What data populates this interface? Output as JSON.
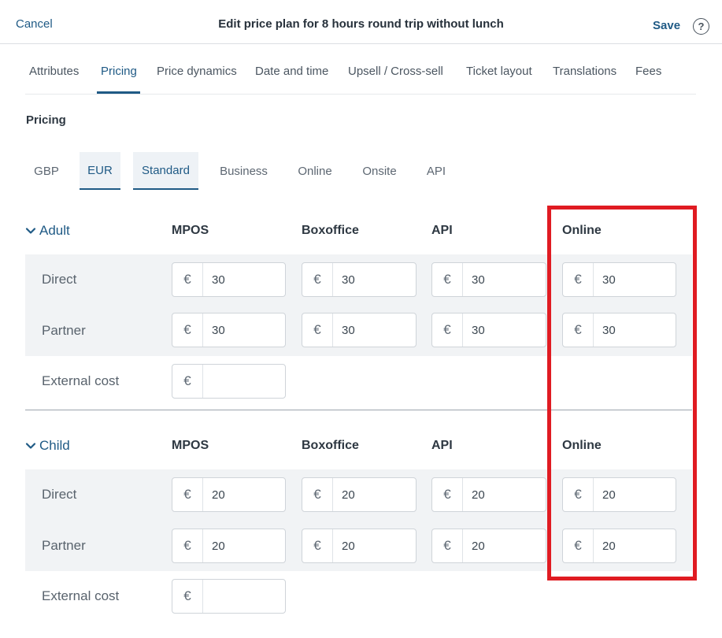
{
  "header": {
    "cancel_label": "Cancel",
    "title": "Edit price plan for 8 hours round trip without lunch",
    "save_label": "Save",
    "help_icon": "?"
  },
  "tabs": [
    {
      "label": "Attributes"
    },
    {
      "label": "Pricing",
      "active": true
    },
    {
      "label": "Price dynamics"
    },
    {
      "label": "Date and time"
    },
    {
      "label": "Upsell / Cross-sell"
    },
    {
      "label": "Ticket layout"
    },
    {
      "label": "Translations"
    },
    {
      "label": "Fees"
    }
  ],
  "pricing": {
    "section_title": "Pricing",
    "subtabs": [
      {
        "label": "GBP"
      },
      {
        "label": "EUR",
        "active": true
      },
      {
        "label": "Standard",
        "active": true
      },
      {
        "label": "Business"
      },
      {
        "label": "Online"
      },
      {
        "label": "Onsite"
      },
      {
        "label": "API"
      }
    ],
    "columns": [
      "MPOS",
      "Boxoffice",
      "API",
      "Online"
    ],
    "currency_symbol": "€",
    "groups": [
      {
        "name": "Adult",
        "rows": [
          {
            "label": "Direct",
            "values": [
              "30",
              "30",
              "30",
              "30"
            ]
          },
          {
            "label": "Partner",
            "values": [
              "30",
              "30",
              "30",
              "30"
            ]
          }
        ],
        "external_cost_label": "External cost",
        "external_cost_value": ""
      },
      {
        "name": "Child",
        "rows": [
          {
            "label": "Direct",
            "values": [
              "20",
              "20",
              "20",
              "20"
            ]
          },
          {
            "label": "Partner",
            "values": [
              "20",
              "20",
              "20",
              "20"
            ]
          }
        ],
        "external_cost_label": "External cost",
        "external_cost_value": ""
      }
    ]
  },
  "colors": {
    "accent": "#1f5a85",
    "highlight_border": "#e01b22",
    "row_band": "#f1f3f5"
  }
}
